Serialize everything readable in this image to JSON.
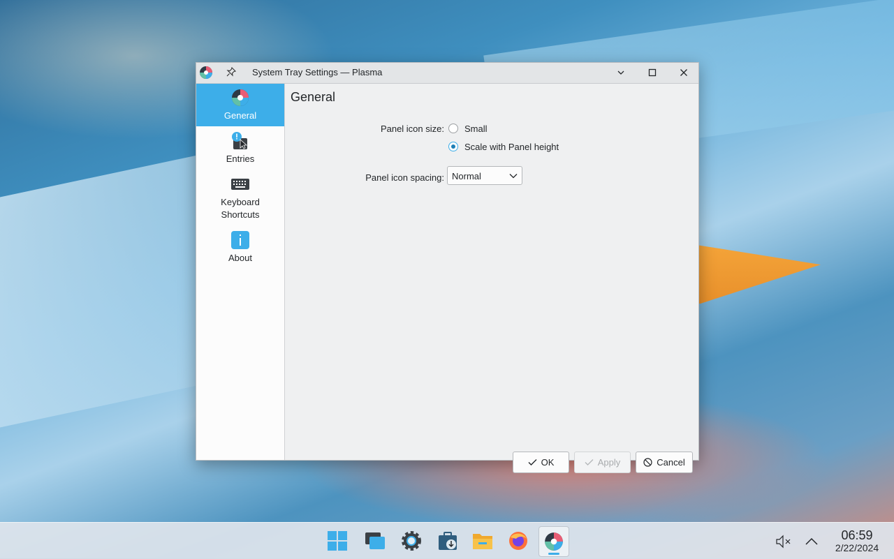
{
  "window": {
    "title": "System Tray Settings — Plasma"
  },
  "sidebar": {
    "items": [
      {
        "label": "General",
        "active": true
      },
      {
        "label": "Entries",
        "active": false
      },
      {
        "label": "Keyboard Shortcuts",
        "active": false
      },
      {
        "label": "About",
        "active": false
      }
    ]
  },
  "page": {
    "title": "General",
    "icon_size_label": "Panel icon size:",
    "icon_size_options": [
      {
        "label": "Small",
        "checked": false
      },
      {
        "label": "Scale with Panel height",
        "checked": true
      }
    ],
    "spacing_label": "Panel icon spacing:",
    "spacing_value": "Normal"
  },
  "buttons": {
    "ok": "OK",
    "apply": "Apply",
    "cancel": "Cancel"
  },
  "taskbar": {
    "apps": [
      "application-launcher",
      "show-desktop",
      "system-settings",
      "discover",
      "file-manager",
      "firefox",
      "system-tray-settings"
    ],
    "time": "06:59",
    "date": "2/22/2024"
  },
  "colors": {
    "accent": "#3daee9",
    "window_bg": "#eff0f1"
  }
}
